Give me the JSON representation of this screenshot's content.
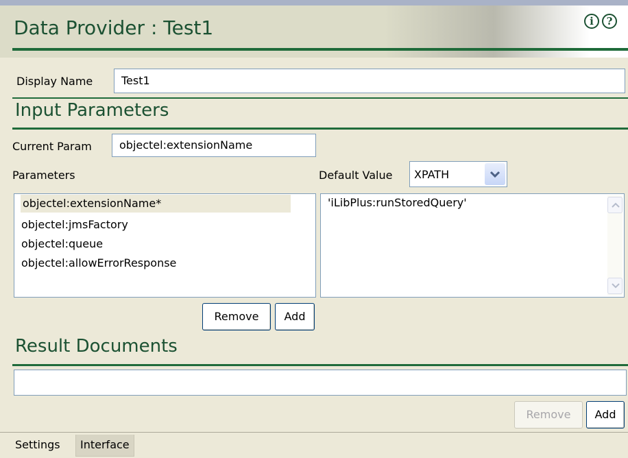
{
  "header": {
    "title": "Data Provider : Test1"
  },
  "display_name": {
    "label": "Display Name",
    "value": "Test1"
  },
  "input_parameters": {
    "title": "Input Parameters",
    "current_param_label": "Current Param",
    "current_param_value": "objectel:extensionName",
    "parameters_label": "Parameters",
    "default_value_label": "Default Value",
    "default_value_type": "XPATH",
    "parameters": [
      "objectel:extensionName*",
      "objectel:jmsFactory",
      "objectel:queue",
      "objectel:allowErrorResponse"
    ],
    "default_value_text": "'iLibPlus:runStoredQuery'",
    "remove_label": "Remove",
    "add_label": "Add"
  },
  "result_documents": {
    "title": "Result Documents",
    "remove_label": "Remove",
    "add_label": "Add"
  },
  "tabs": [
    "Settings",
    "Interface"
  ],
  "colors": {
    "accent": "#1b5132",
    "rule": "#1f6b3a",
    "background": "#ece9d8"
  }
}
